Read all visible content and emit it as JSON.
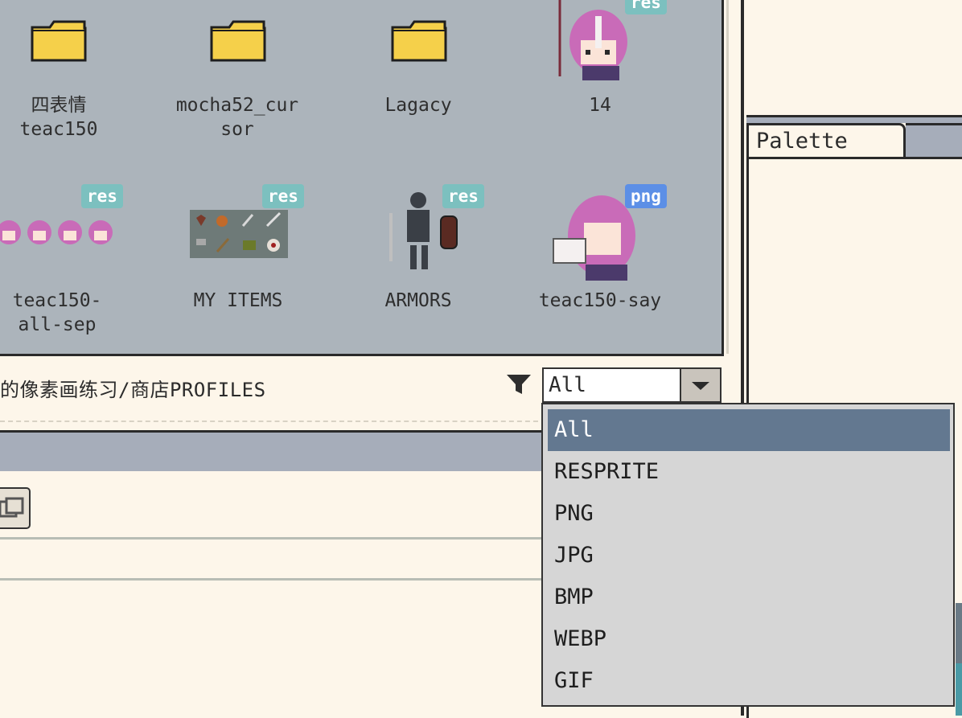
{
  "files": [
    {
      "name": "四表情\nteac150",
      "type": "folder"
    },
    {
      "name": "mocha52_cur\nsor",
      "type": "folder"
    },
    {
      "name": "Lagacy",
      "type": "folder"
    },
    {
      "name": "14",
      "type": "res"
    },
    {
      "name": "teac150-\nall-sep",
      "type": "res"
    },
    {
      "name": "MY ITEMS",
      "type": "res"
    },
    {
      "name": "ARMORS",
      "type": "res"
    },
    {
      "name": "teac150-say",
      "type": "png"
    }
  ],
  "badges": {
    "res": "res",
    "png": "png"
  },
  "path": "的像素画练习/商店PROFILES",
  "filter": {
    "selected": "All",
    "icon": "funnel-icon"
  },
  "dropdown_options": [
    "All",
    "RESPRITE",
    "PNG",
    "JPG",
    "BMP",
    "WEBP",
    "GIF"
  ],
  "right_panel": {
    "palette_tab": "Palette"
  },
  "colors": {
    "selected_option": "#637890",
    "res_badge": "#7cc0bf",
    "png_badge": "#5c8fe6",
    "folder": "#f5d04a"
  }
}
